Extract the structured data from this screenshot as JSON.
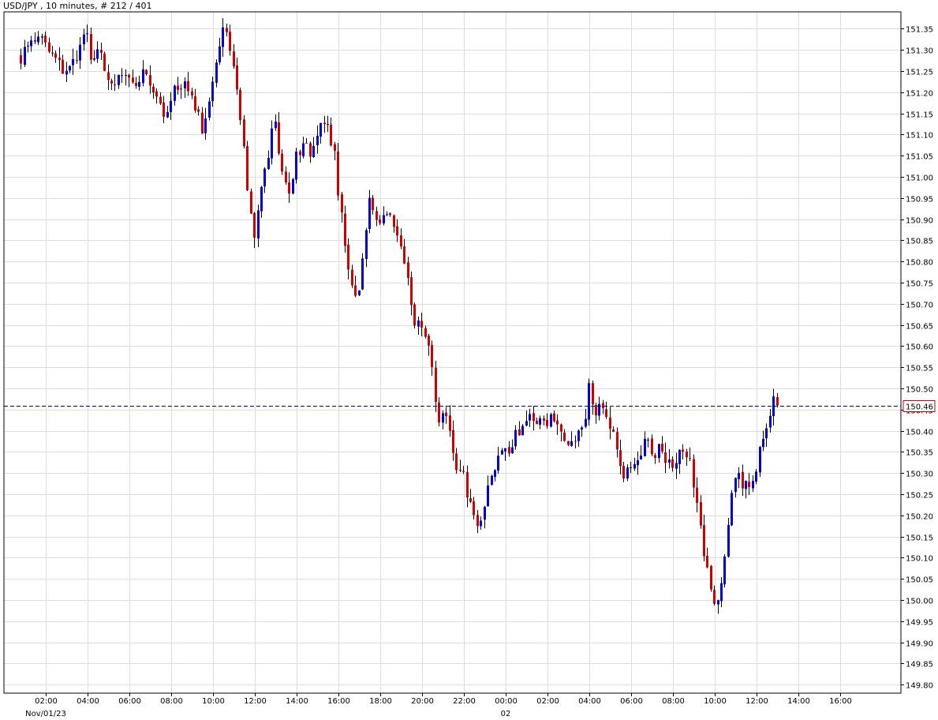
{
  "header": {
    "title": "USD/JPY , 10 minutes, # 212 / 401"
  },
  "chart_data": {
    "type": "candlestick",
    "symbol": "USD/JPY",
    "interval": "10 minutes",
    "ylim": [
      149.78,
      151.39
    ],
    "xlim": [
      -1.0,
      20.45
    ],
    "grid": true,
    "y_ticks": [
      "151.35",
      "151.30",
      "151.25",
      "151.20",
      "151.15",
      "151.10",
      "151.05",
      "151.00",
      "150.95",
      "150.90",
      "150.85",
      "150.80",
      "150.75",
      "150.70",
      "150.65",
      "150.60",
      "150.55",
      "150.50",
      "150.45",
      "150.40",
      "150.35",
      "150.30",
      "150.25",
      "150.20",
      "150.15",
      "150.10",
      "150.05",
      "150.00",
      "149.95",
      "149.90",
      "149.85",
      "149.80"
    ],
    "x_ticks": [
      {
        "t": 0,
        "label": "02:00"
      },
      {
        "t": 1,
        "label": "04:00"
      },
      {
        "t": 2,
        "label": "06:00"
      },
      {
        "t": 3,
        "label": "08:00"
      },
      {
        "t": 4,
        "label": "10:00"
      },
      {
        "t": 5,
        "label": "12:00"
      },
      {
        "t": 6,
        "label": "14:00"
      },
      {
        "t": 7,
        "label": "16:00"
      },
      {
        "t": 8,
        "label": "18:00"
      },
      {
        "t": 9,
        "label": "20:00"
      },
      {
        "t": 10,
        "label": "22:00"
      },
      {
        "t": 11,
        "label": "00:00"
      },
      {
        "t": 12,
        "label": "02:00"
      },
      {
        "t": 13,
        "label": "04:00"
      },
      {
        "t": 14,
        "label": "06:00"
      },
      {
        "t": 15,
        "label": "08:00"
      },
      {
        "t": 16,
        "label": "10:00"
      },
      {
        "t": 17,
        "label": "12:00"
      },
      {
        "t": 18,
        "label": "14:00"
      },
      {
        "t": 19,
        "label": "16:00"
      }
    ],
    "date_labels": [
      {
        "t": 0,
        "label": "Nov/01/23"
      },
      {
        "t": 11,
        "label": "02"
      }
    ],
    "current_price": "150.46",
    "current_value": 150.46,
    "colors": {
      "up": "#0000cc",
      "down": "#cc0000",
      "grid": "#dcdcdc",
      "price_line": "#000080",
      "price_box": "#cc0000"
    },
    "anchors": [
      [
        -0.6,
        151.28
      ],
      [
        -0.3,
        151.32
      ],
      [
        0.0,
        151.32
      ],
      [
        0.3,
        151.27
      ],
      [
        0.5,
        151.25
      ],
      [
        0.8,
        151.3
      ],
      [
        0.95,
        151.38
      ],
      [
        1.1,
        151.26
      ],
      [
        1.3,
        151.31
      ],
      [
        1.5,
        151.22
      ],
      [
        1.8,
        151.25
      ],
      [
        2.0,
        151.22
      ],
      [
        2.3,
        151.24
      ],
      [
        2.6,
        151.2
      ],
      [
        2.9,
        151.14
      ],
      [
        3.1,
        151.21
      ],
      [
        3.3,
        151.22
      ],
      [
        3.5,
        151.18
      ],
      [
        3.75,
        151.11
      ],
      [
        3.9,
        151.18
      ],
      [
        4.1,
        151.27
      ],
      [
        4.2,
        151.38
      ],
      [
        4.35,
        151.33
      ],
      [
        4.5,
        151.25
      ],
      [
        4.65,
        151.13
      ],
      [
        4.8,
        151.0
      ],
      [
        4.95,
        150.85
      ],
      [
        5.1,
        150.95
      ],
      [
        5.3,
        151.05
      ],
      [
        5.45,
        151.15
      ],
      [
        5.6,
        151.02
      ],
      [
        5.8,
        150.97
      ],
      [
        6.0,
        151.05
      ],
      [
        6.2,
        151.08
      ],
      [
        6.35,
        151.05
      ],
      [
        6.5,
        151.12
      ],
      [
        6.7,
        151.15
      ],
      [
        6.9,
        151.05
      ],
      [
        7.0,
        150.95
      ],
      [
        7.2,
        150.8
      ],
      [
        7.3,
        150.75
      ],
      [
        7.45,
        150.72
      ],
      [
        7.6,
        150.82
      ],
      [
        7.75,
        150.95
      ],
      [
        7.9,
        150.9
      ],
      [
        8.1,
        150.92
      ],
      [
        8.3,
        150.9
      ],
      [
        8.45,
        150.86
      ],
      [
        8.65,
        150.76
      ],
      [
        8.8,
        150.66
      ],
      [
        9.0,
        150.64
      ],
      [
        9.2,
        150.58
      ],
      [
        9.35,
        150.43
      ],
      [
        9.55,
        150.45
      ],
      [
        9.75,
        150.33
      ],
      [
        9.95,
        150.3
      ],
      [
        10.15,
        150.23
      ],
      [
        10.3,
        150.18
      ],
      [
        10.5,
        150.23
      ],
      [
        10.7,
        150.3
      ],
      [
        10.9,
        150.37
      ],
      [
        11.05,
        150.34
      ],
      [
        11.25,
        150.4
      ],
      [
        11.45,
        150.42
      ],
      [
        11.65,
        150.43
      ],
      [
        11.85,
        150.41
      ],
      [
        12.1,
        150.44
      ],
      [
        12.3,
        150.4
      ],
      [
        12.5,
        150.36
      ],
      [
        12.7,
        150.39
      ],
      [
        12.9,
        150.43
      ],
      [
        13.0,
        150.54
      ],
      [
        13.1,
        150.4
      ],
      [
        13.25,
        150.48
      ],
      [
        13.4,
        150.44
      ],
      [
        13.6,
        150.39
      ],
      [
        13.8,
        150.28
      ],
      [
        14.0,
        150.32
      ],
      [
        14.2,
        150.34
      ],
      [
        14.35,
        150.38
      ],
      [
        14.55,
        150.35
      ],
      [
        14.7,
        150.37
      ],
      [
        14.85,
        150.32
      ],
      [
        15.0,
        150.31
      ],
      [
        15.2,
        150.35
      ],
      [
        15.4,
        150.33
      ],
      [
        15.55,
        150.23
      ],
      [
        15.75,
        150.09
      ],
      [
        15.95,
        150.0
      ],
      [
        16.1,
        150.0
      ],
      [
        16.25,
        150.12
      ],
      [
        16.45,
        150.3
      ],
      [
        16.65,
        150.28
      ],
      [
        16.85,
        150.27
      ],
      [
        17.0,
        150.31
      ],
      [
        17.15,
        150.39
      ],
      [
        17.3,
        150.44
      ],
      [
        17.45,
        150.48
      ],
      [
        17.55,
        150.46
      ]
    ]
  }
}
